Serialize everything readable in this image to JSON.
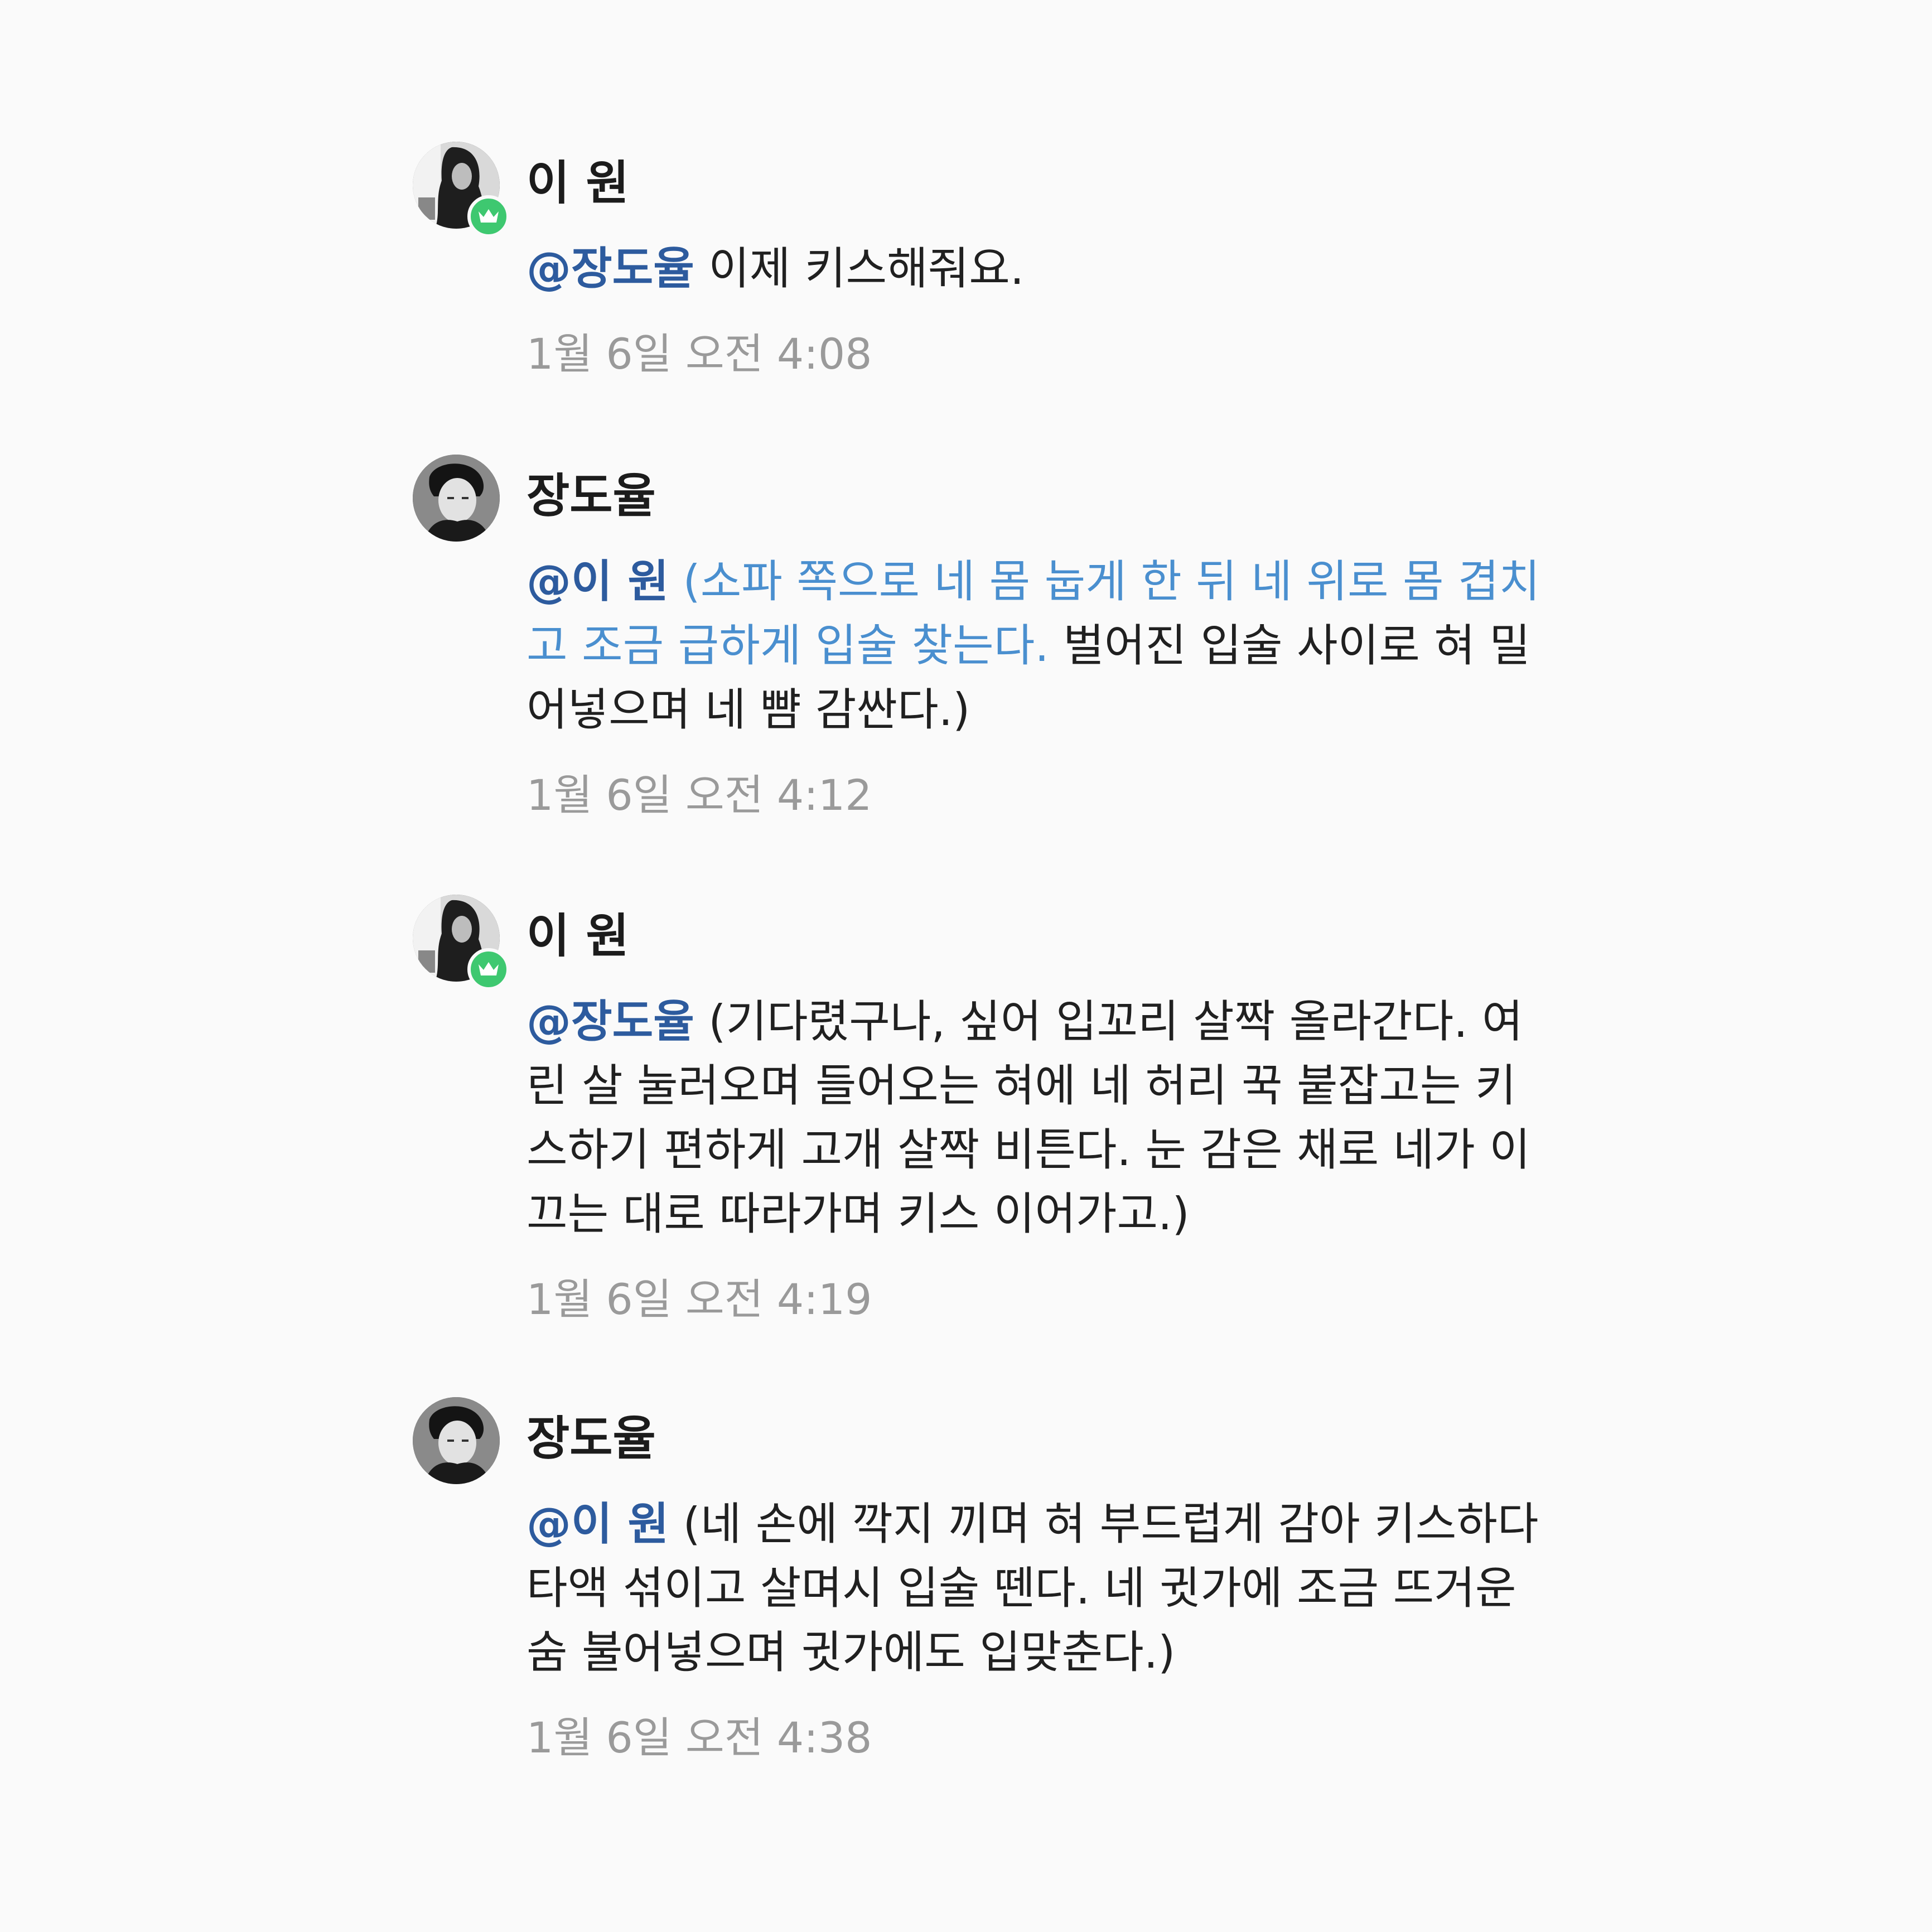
{
  "messages": [
    {
      "sender": "이 원",
      "mention": "@장도율",
      "action": "",
      "text": " 이제 키스해줘요.",
      "timestamp": "1월 6일 오전 4:08"
    },
    {
      "sender": "장도율",
      "mention": "@이 원",
      "action": " (소파 쪽으로 네 몸 눕게 한 뒤 네 위로 몸 겹치고 조금 급하게 입술 찾는다.",
      "text": " 벌어진 입술 사이로 혀 밀어넣으며 네 뺨 감싼다.)",
      "timestamp": "1월 6일 오전 4:12"
    },
    {
      "sender": "이 원",
      "mention": "@장도율",
      "action": "",
      "text": " (기다렸구나, 싶어 입꼬리 살짝 올라간다. 여린 살 눌러오며 들어오는 혀에 네 허리 꾹 붙잡고는 키스하기 편하게 고개 살짝 비튼다. 눈 감은 채로 네가 이끄는 대로 따라가며 키스 이어가고.)",
      "timestamp": "1월 6일 오전 4:19"
    },
    {
      "sender": "장도율",
      "mention": "@이 원",
      "action": "",
      "text": " (네 손에 깍지 끼며 혀 부드럽게 감아 키스하다 타액 섞이고 살며시 입술 뗀다. 네 귓가에 조금 뜨거운 숨 불어넣으며 귓가에도 입맞춘다.)",
      "timestamp": "1월 6일 오전 4:38"
    }
  ],
  "colors": {
    "background": "#fafafa",
    "mention": "#2d5b9e",
    "action": "#4a8fcf",
    "timestamp": "#9a9a9a",
    "badge": "#3ec870"
  },
  "icons": {
    "owner_badge": "crown-icon"
  }
}
